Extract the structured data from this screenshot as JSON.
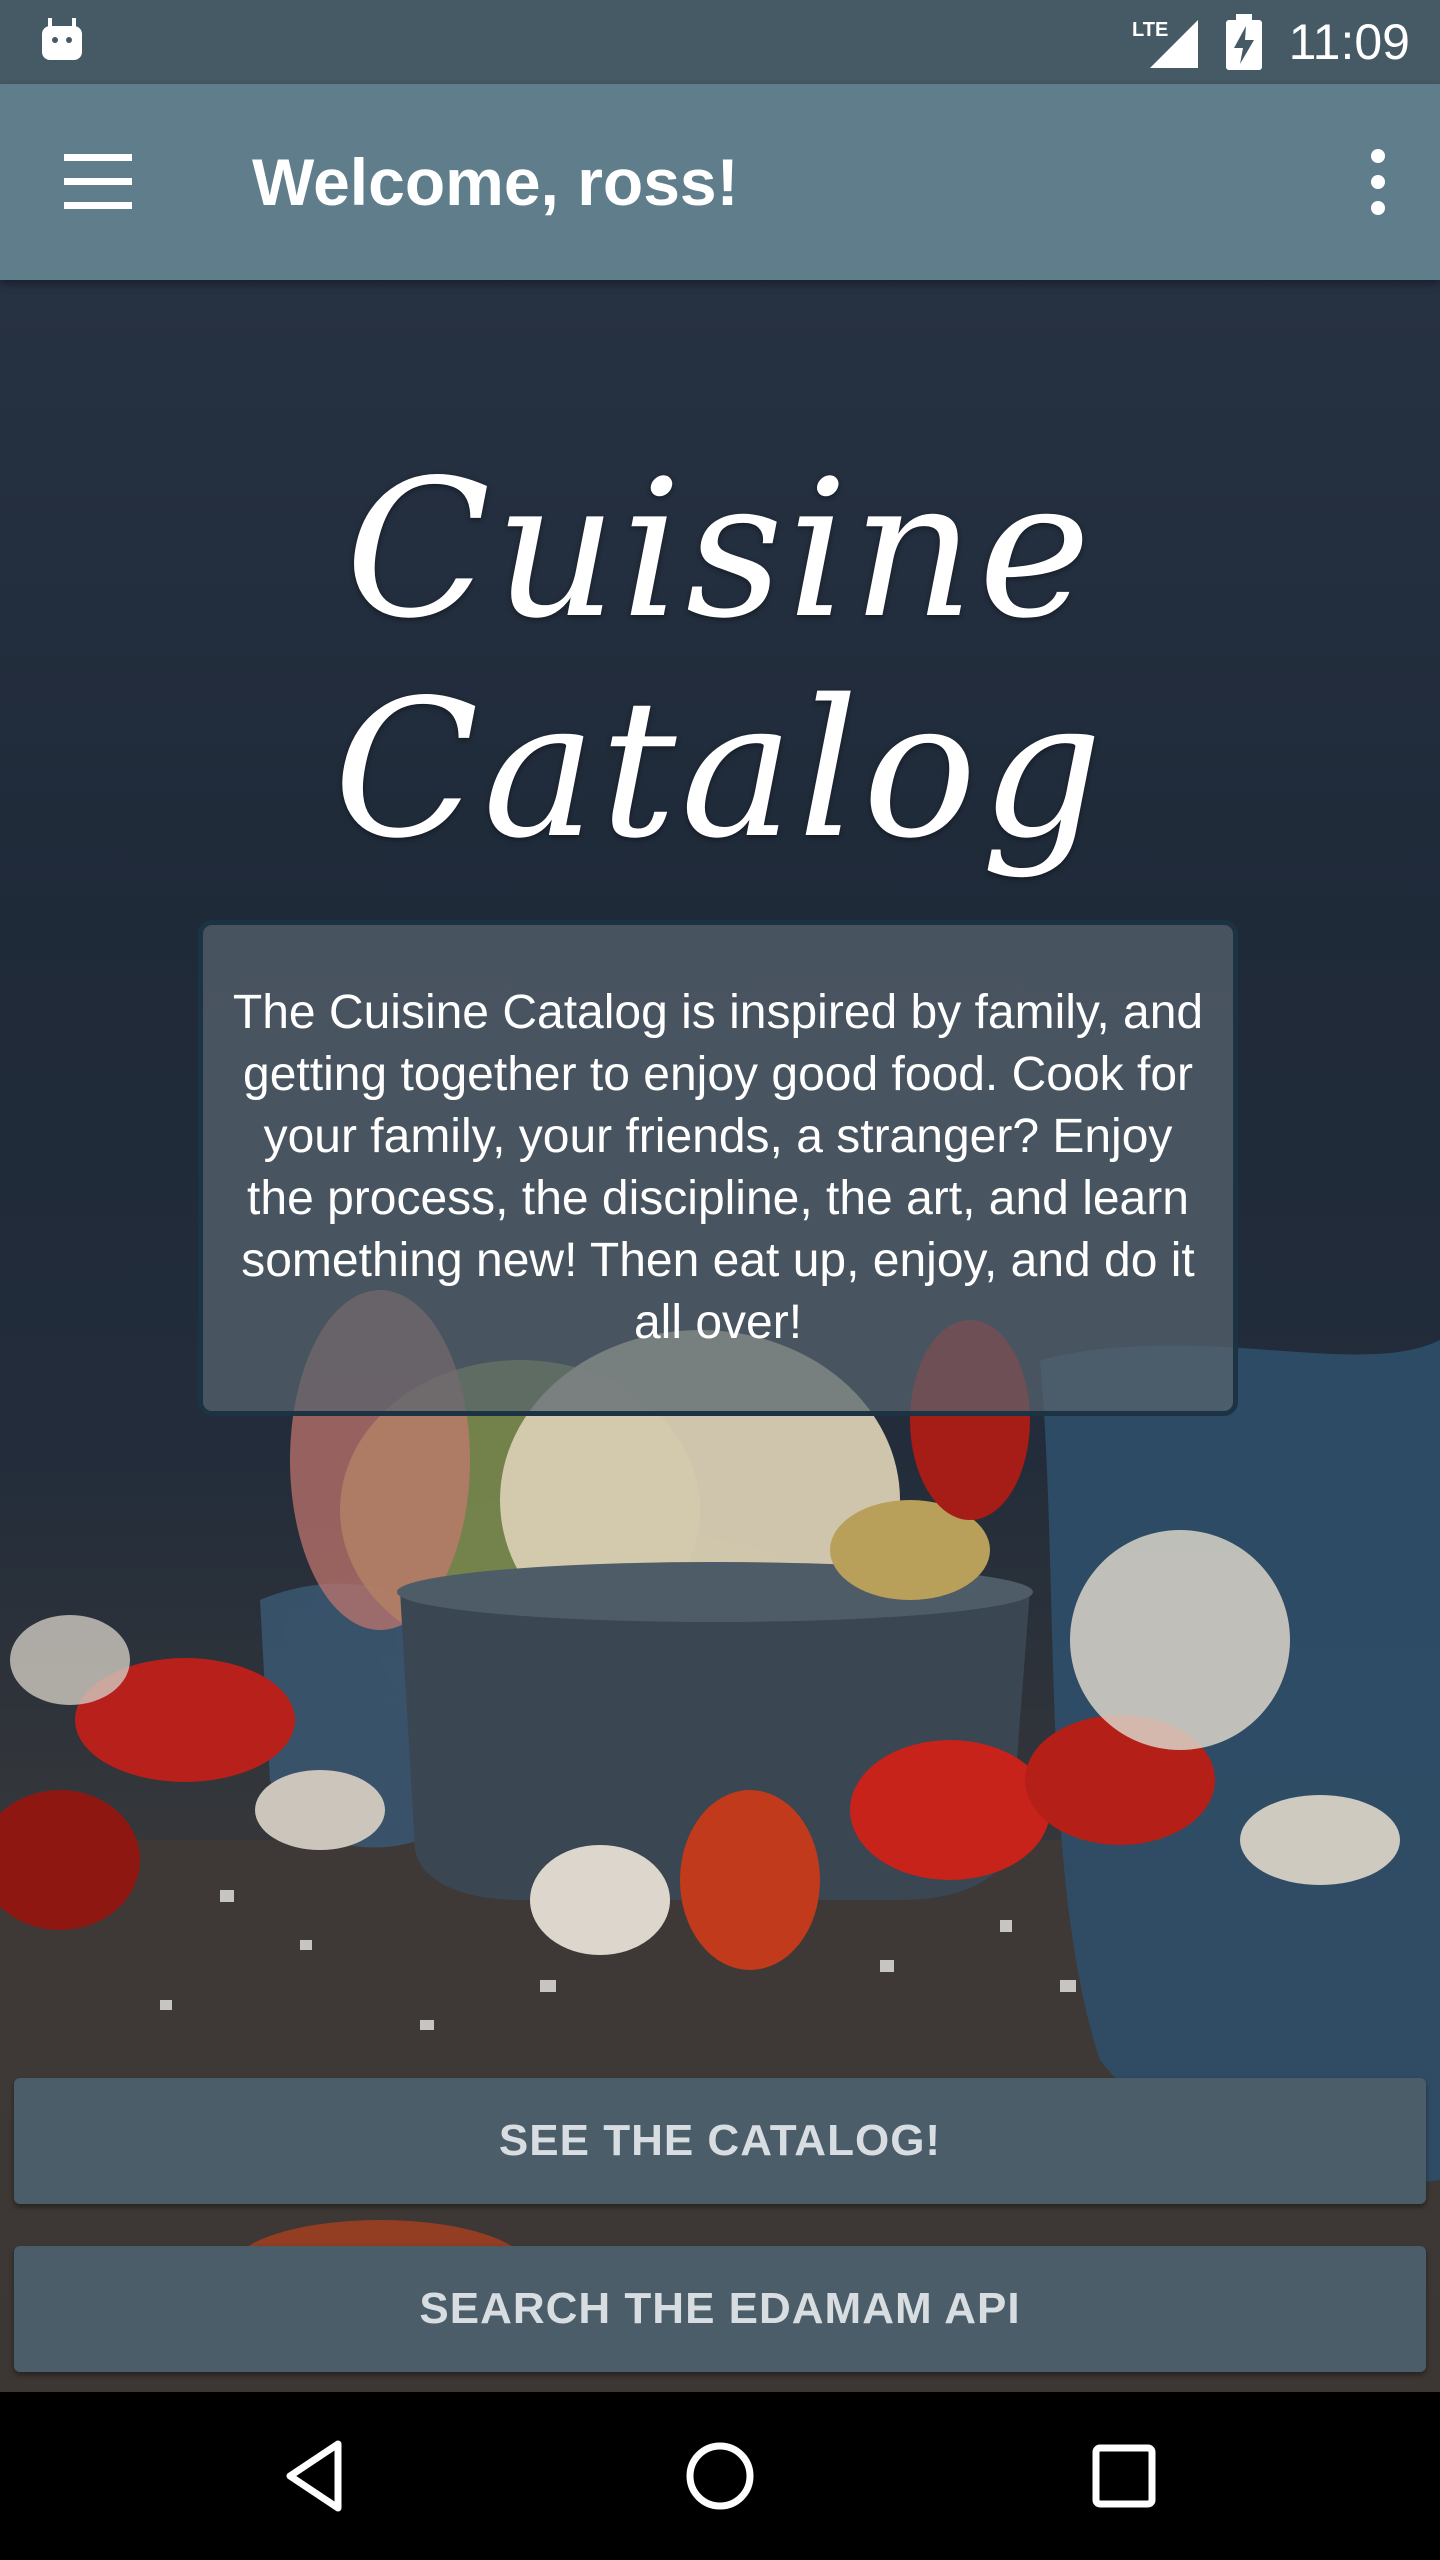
{
  "status_bar": {
    "time": "11:09",
    "network_label": "LTE",
    "icons": [
      "android-icon",
      "lte-signal-icon",
      "battery-charging-icon"
    ]
  },
  "app_bar": {
    "title": "Welcome, ross!",
    "icons": [
      "menu-icon",
      "overflow-menu-icon"
    ]
  },
  "hero": {
    "logo_text": "Cuisine Catalog",
    "intro": "The Cuisine Catalog is inspired by family, and getting together to enjoy good food. Cook for your family, your friends, a stranger? Enjoy the process, the discipline, the art, and learn something new! Then eat up, enjoy, and do it all over!"
  },
  "buttons": {
    "catalog": "SEE THE CATALOG!",
    "search": "SEARCH THE EDAMAM API"
  },
  "nav_bar": {
    "icons": [
      "back-icon",
      "home-icon",
      "recents-icon"
    ]
  },
  "colors": {
    "status_bar": "#455a64",
    "app_bar": "#607d8b",
    "button": "#4b5d68",
    "button_text": "#d7dde1"
  }
}
